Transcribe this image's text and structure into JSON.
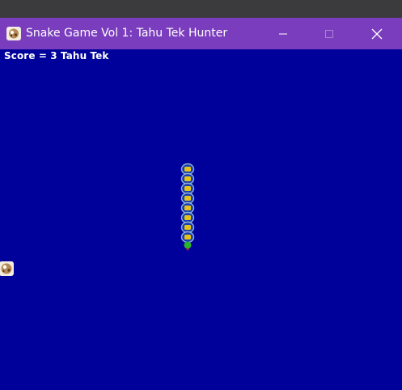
{
  "window": {
    "title": "Snake Game Vol 1: Tahu Tek Hunter",
    "titlebar_color": "#7a3dbd",
    "icon": "snake-game-app-icon",
    "controls": [
      "minimize-icon",
      "maximize-icon",
      "close-icon"
    ]
  },
  "game": {
    "background_color": "#00009a",
    "score_text": "Score = 3 Tahu Tek",
    "snake": {
      "body_segments": 8,
      "direction": "up",
      "head_color": "#2ab52a",
      "body_color": "#e3c21a",
      "outline_color": "#8fb0d8"
    },
    "food": {
      "icon": "tahu-tek-food-icon"
    }
  }
}
